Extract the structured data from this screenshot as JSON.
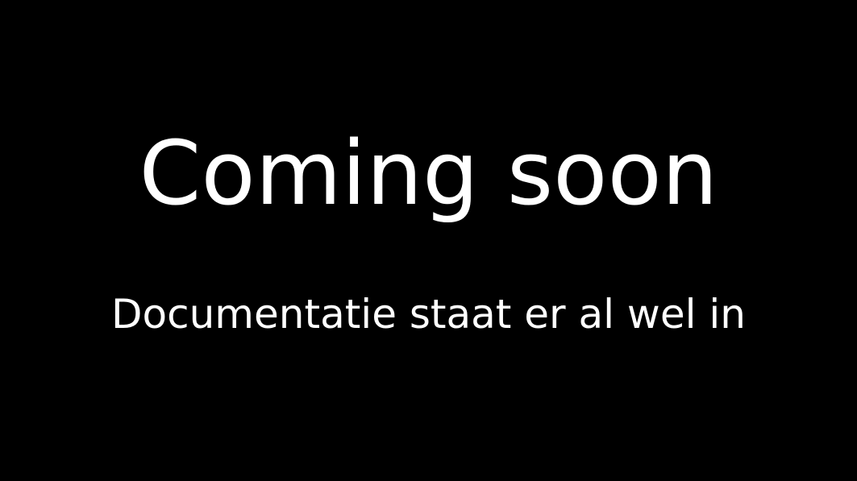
{
  "page": {
    "background_color": "#000000",
    "text_color": "#ffffff",
    "title": "Coming soon",
    "subtitle": "Documentatie staat er al wel in"
  }
}
